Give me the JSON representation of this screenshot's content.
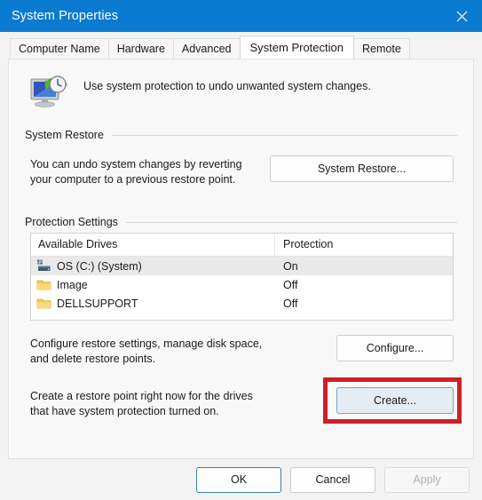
{
  "window": {
    "title": "System Properties",
    "close_icon": "close-icon"
  },
  "tabs": [
    {
      "label": "Computer Name",
      "active": false
    },
    {
      "label": "Hardware",
      "active": false
    },
    {
      "label": "Advanced",
      "active": false
    },
    {
      "label": "System Protection",
      "active": true
    },
    {
      "label": "Remote",
      "active": false
    }
  ],
  "header": {
    "icon": "system-protection-icon",
    "text": "Use system protection to undo unwanted system changes."
  },
  "system_restore": {
    "group_title": "System Restore",
    "description": "You can undo system changes by reverting your computer to a previous restore point.",
    "button_label": "System Restore..."
  },
  "protection_settings": {
    "group_title": "Protection Settings",
    "columns": [
      "Available Drives",
      "Protection"
    ],
    "rows": [
      {
        "icon": "hard-drive-icon",
        "drive": "OS (C:) (System)",
        "protection": "On",
        "selected": true
      },
      {
        "icon": "folder-icon",
        "drive": "Image",
        "protection": "Off",
        "selected": false
      },
      {
        "icon": "folder-icon",
        "drive": "DELLSUPPORT",
        "protection": "Off",
        "selected": false
      }
    ],
    "configure": {
      "description": "Configure restore settings, manage disk space, and delete restore points.",
      "button_label": "Configure..."
    },
    "create": {
      "description": "Create a restore point right now for the drives that have system protection turned on.",
      "button_label": "Create...",
      "highlighted": true
    }
  },
  "footer": {
    "ok_label": "OK",
    "cancel_label": "Cancel",
    "apply_label": "Apply"
  },
  "colors": {
    "titlebar": "#0b7ad1",
    "annotation": "#cc2027",
    "highlight_button_fill": "#e4edf4",
    "selection": "#e9e9e9"
  }
}
